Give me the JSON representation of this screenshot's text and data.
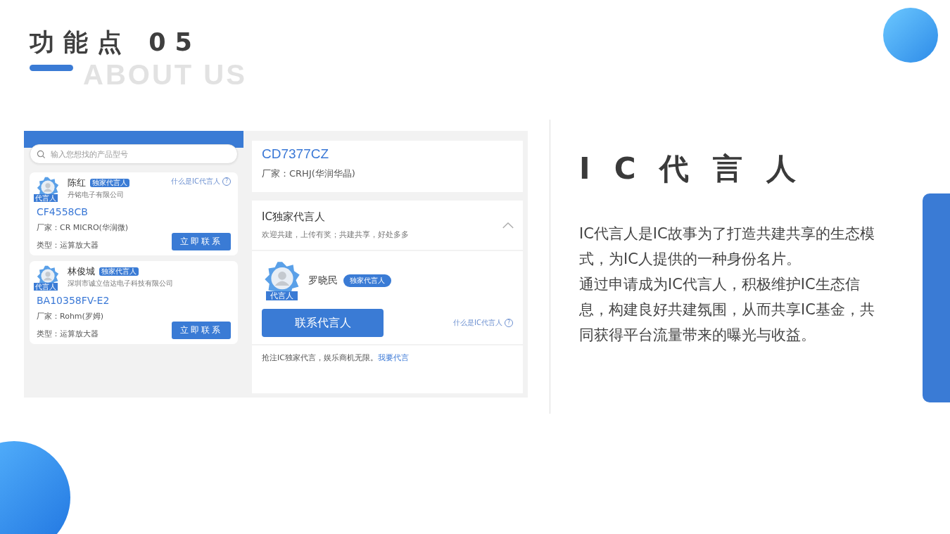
{
  "header": {
    "title": "功能点 05",
    "backdrop": "ABOUT US"
  },
  "app": {
    "search": {
      "placeholder": "输入您想找的产品型号"
    },
    "cards": [
      {
        "avatar_label": "代言人",
        "name": "陈红",
        "badge": "独家代言人",
        "company": "丹铭电子有限公司",
        "help_link": "什么是IC代言人",
        "help_icon": "?",
        "part": "CF4558CB",
        "maker": "厂家：CR MICRO(华润微)",
        "type": "类型：运算放大器",
        "button": "立即联系"
      },
      {
        "avatar_label": "代言人",
        "name": "林俊城",
        "badge": "独家代言人",
        "company": "深圳市诚立信达电子科技有限公司",
        "part": "BA10358FV-E2",
        "maker": "厂家：Rohm(罗姆)",
        "type": "类型：运算放大器",
        "button": "立即联系"
      }
    ],
    "product": {
      "part": "CD7377CZ",
      "maker": "厂家：CRHJ(华润华晶)"
    },
    "spokesperson": {
      "title": "IC独家代言人",
      "subtitle": "欢迎共建，上传有奖；共建共享，好处多多",
      "expanded": true,
      "avatar_label": "代言人",
      "name": "罗晓民",
      "badge": "独家代言人",
      "button": "联系代言人",
      "help_link": "什么是IC代言人",
      "help_icon": "?",
      "footer": "抢注IC独家代言，娱乐商机无限。",
      "footer_link": "我要代言"
    }
  },
  "feature": {
    "title": "IC代言人",
    "paragraphs": [
      "IC代言人是IC故事为了打造共建共享的生态模式，为IC人提供的一种身份名片。",
      "通过申请成为IC代言人，积极维护IC生态信息，构建良好共建氛围，从而共享IC基金，共同获得平台流量带来的曝光与收益。"
    ]
  }
}
